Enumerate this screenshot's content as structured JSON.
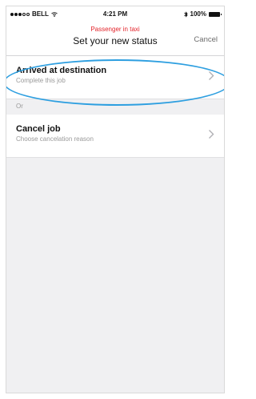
{
  "status_bar": {
    "carrier": "BELL",
    "time": "4:21 PM",
    "battery": "100%"
  },
  "nav": {
    "subtitle": "Passenger in taxi",
    "title": "Set your new status",
    "cancel_label": "Cancel"
  },
  "options": [
    {
      "title": "Arrived at destination",
      "subtitle": "Complete this job"
    },
    {
      "title": "Cancel job",
      "subtitle": "Choose cancelation reason"
    }
  ],
  "section_label": "Or",
  "colors": {
    "subtitle_red": "#e3242b",
    "highlight_blue": "#2e9fe0",
    "background_gray": "#f0f0f2"
  },
  "icons": {
    "chevron": "chevron-right-icon",
    "signal": "signal-dots-icon",
    "wifi": "wifi-icon",
    "bluetooth": "bluetooth-icon",
    "battery": "battery-icon"
  }
}
